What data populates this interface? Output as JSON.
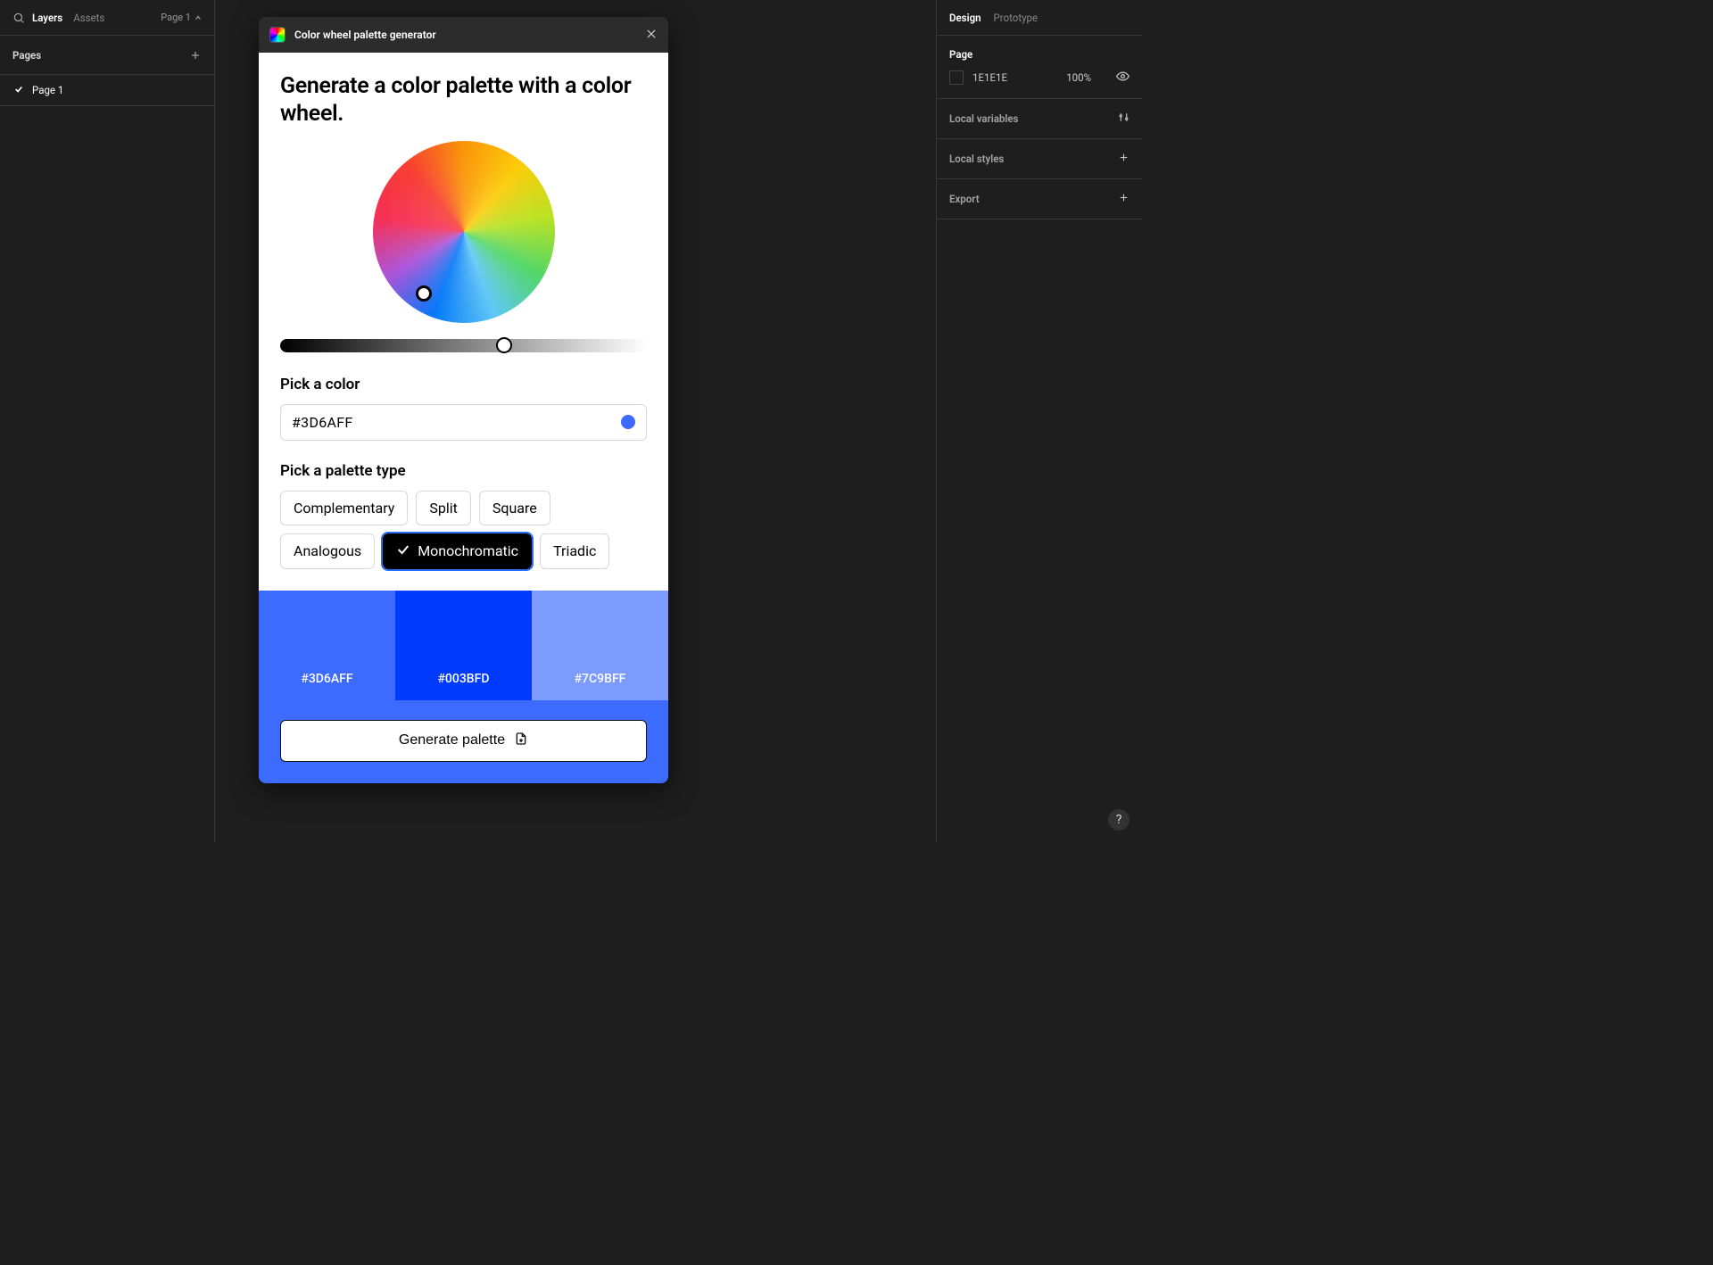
{
  "left": {
    "tabs": {
      "layers": "Layers",
      "assets": "Assets"
    },
    "page_button": "Page 1",
    "pages_label": "Pages",
    "pages": [
      "Page 1"
    ]
  },
  "right": {
    "tabs": {
      "design": "Design",
      "prototype": "Prototype"
    },
    "page_section": {
      "title": "Page",
      "hex": "1E1E1E",
      "opacity": "100%"
    },
    "sections": {
      "local_variables": "Local variables",
      "local_styles": "Local styles",
      "export": "Export"
    }
  },
  "plugin": {
    "title": "Color wheel palette generator",
    "heading": "Generate a color palette with a color wheel.",
    "pick_color_label": "Pick a color",
    "color_value": "#3D6AFF",
    "color_dot": "#3D6AFF",
    "pick_palette_label": "Pick a palette type",
    "types": [
      "Complementary",
      "Split",
      "Square",
      "Analogous",
      "Monochromatic",
      "Triadic"
    ],
    "selected_type_index": 4,
    "palette": [
      {
        "hex": "#3D6AFF"
      },
      {
        "hex": "#003BFD"
      },
      {
        "hex": "#7C9BFF"
      }
    ],
    "generate_bar_bg": "#3D6AFF",
    "generate_label": "Generate palette"
  },
  "help_label": "?"
}
